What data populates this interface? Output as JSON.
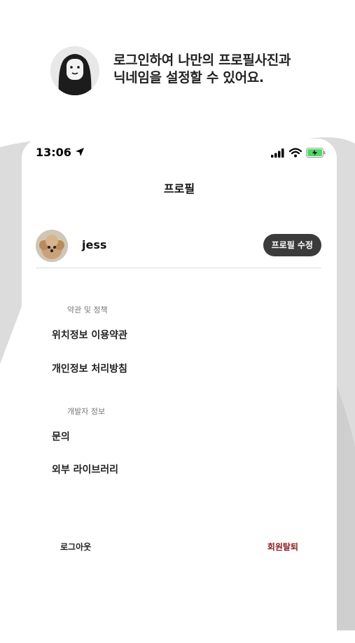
{
  "promo": {
    "line1": "로그인하여 나만의 프로필사진과",
    "line2": "닉네임을 설정할 수 있어요."
  },
  "status_bar": {
    "time": "13:06"
  },
  "header": {
    "title": "프로필"
  },
  "profile": {
    "username": "jess",
    "edit_button_label": "프로필 수정"
  },
  "sections": [
    {
      "label": "약관 및 정책",
      "items": [
        "위치정보 이용약관",
        "개인정보 처리방침"
      ]
    },
    {
      "label": "개발자 정보",
      "items": [
        "문의",
        "외부 라이브러리"
      ]
    }
  ],
  "footer": {
    "logout_label": "로그아웃",
    "withdraw_label": "회원탈퇴"
  },
  "colors": {
    "background_shape": "#d9d9d9",
    "edit_button": "#3b3b3b",
    "withdraw_text": "#8b1d1d",
    "section_label": "#777777"
  }
}
